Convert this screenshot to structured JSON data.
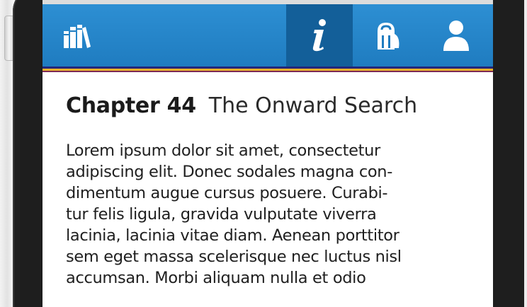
{
  "navbar": {
    "items": [
      {
        "name": "library",
        "icon": "library-books-icon",
        "active": false
      },
      {
        "name": "info",
        "icon": "info-icon",
        "active": true
      },
      {
        "name": "backpack",
        "icon": "backpack-icon",
        "active": false
      },
      {
        "name": "profile",
        "icon": "user-icon",
        "active": false
      }
    ],
    "colors": {
      "bar": "#2387cc",
      "active": "#135f99",
      "stripe_navy": "#24277a",
      "stripe_gold": "#f0bd2f",
      "stripe_maroon": "#7e2a55"
    }
  },
  "chapter": {
    "number_label": "Chapter 44",
    "title": "The Onward Search"
  },
  "body": {
    "lines": [
      "Lorem ipsum dolor sit amet, consectetur",
      "adipiscing elit. Donec sodales magna con-",
      "dimentum augue cursus posuere. Curabi-",
      "tur felis ligula, gravida vulputate viverra",
      "lacinia, lacinia vitae diam. Aenean porttitor",
      "sem eget massa scelerisque nec luctus nisl",
      "accumsan. Morbi aliquam nulla et odio"
    ]
  }
}
